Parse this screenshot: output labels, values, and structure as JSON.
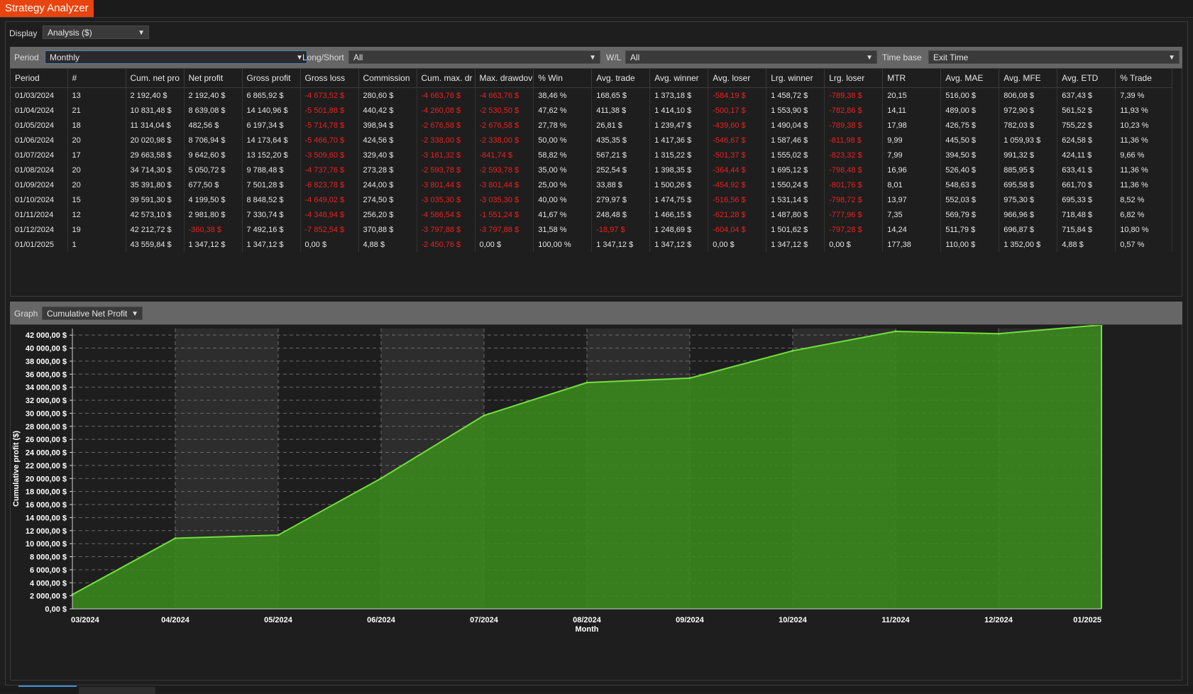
{
  "app": {
    "title": "Strategy Analyzer"
  },
  "display": {
    "label": "Display",
    "value": "Analysis ($)"
  },
  "filters": [
    {
      "label": "Period",
      "value": "Monthly"
    },
    {
      "label": "Long/Short",
      "value": "All"
    },
    {
      "label": "W/L",
      "value": "All"
    },
    {
      "label": "Time base",
      "value": "Exit Time"
    }
  ],
  "colors": {
    "accent": "#e8440f",
    "negative": "#ee2020",
    "area_fill": "#3a8a1e",
    "line": "#72e03a",
    "band": "#2d2d2d"
  },
  "table": {
    "columns": [
      "Period",
      "#",
      "Cum. net pro",
      "Net profit",
      "Gross profit",
      "Gross loss",
      "Commission",
      "Cum. max. dr",
      "Max. drawdov",
      "% Win",
      "Avg. trade",
      "Avg. winner",
      "Avg. loser",
      "Lrg. winner",
      "Lrg. loser",
      "MTR",
      "Avg. MAE",
      "Avg. MFE",
      "Avg. ETD",
      "% Trade"
    ],
    "rows": [
      [
        "01/03/2024",
        "13",
        "2 192,40 $",
        "2 192,40 $",
        "6 865,92 $",
        "-4 673,52 $",
        "280,60 $",
        "-4 663,76 $",
        "-4 663,76 $",
        "38,46 %",
        "168,65 $",
        "1 373,18 $",
        "-584,19 $",
        "1 458,72 $",
        "-789,38 $",
        "20,15",
        "516,00 $",
        "806,08 $",
        "637,43 $",
        "7,39 %"
      ],
      [
        "01/04/2024",
        "21",
        "10 831,48 $",
        "8 639,08 $",
        "14 140,96 $",
        "-5 501,88 $",
        "440,42 $",
        "-4 260,08 $",
        "-2 530,50 $",
        "47,62 %",
        "411,38 $",
        "1 414,10 $",
        "-500,17 $",
        "1 553,90 $",
        "-782,86 $",
        "14,11",
        "489,00 $",
        "972,90 $",
        "561,52 $",
        "11,93 %"
      ],
      [
        "01/05/2024",
        "18",
        "11 314,04 $",
        "482,56 $",
        "6 197,34 $",
        "-5 714,78 $",
        "398,94 $",
        "-2 676,58 $",
        "-2 676,58 $",
        "27,78 %",
        "26,81 $",
        "1 239,47 $",
        "-439,60 $",
        "1 490,04 $",
        "-789,38 $",
        "17,98",
        "426,75 $",
        "782,03 $",
        "755,22 $",
        "10,23 %"
      ],
      [
        "01/06/2024",
        "20",
        "20 020,98 $",
        "8 706,94 $",
        "14 173,64 $",
        "-5 466,70 $",
        "424,56 $",
        "-2 338,00 $",
        "-2 338,00 $",
        "50,00 %",
        "435,35 $",
        "1 417,36 $",
        "-546,67 $",
        "1 587,46 $",
        "-811,98 $",
        "9,99",
        "445,50 $",
        "1 059,93 $",
        "624,58 $",
        "11,36 %"
      ],
      [
        "01/07/2024",
        "17",
        "29 663,58 $",
        "9 642,60 $",
        "13 152,20 $",
        "-3 509,60 $",
        "329,40 $",
        "-3 161,32 $",
        "-841,74 $",
        "58,82 %",
        "567,21 $",
        "1 315,22 $",
        "-501,37 $",
        "1 555,02 $",
        "-823,32 $",
        "7,99",
        "394,50 $",
        "991,32 $",
        "424,11 $",
        "9,66 %"
      ],
      [
        "01/08/2024",
        "20",
        "34 714,30 $",
        "5 050,72 $",
        "9 788,48 $",
        "-4 737,76 $",
        "273,28 $",
        "-2 593,78 $",
        "-2 593,78 $",
        "35,00 %",
        "252,54 $",
        "1 398,35 $",
        "-364,44 $",
        "1 695,12 $",
        "-798,48 $",
        "16,96",
        "526,40 $",
        "885,95 $",
        "633,41 $",
        "11,36 %"
      ],
      [
        "01/09/2024",
        "20",
        "35 391,80 $",
        "677,50 $",
        "7 501,28 $",
        "-6 823,78 $",
        "244,00 $",
        "-3 801,44 $",
        "-3 801,44 $",
        "25,00 %",
        "33,88 $",
        "1 500,26 $",
        "-454,92 $",
        "1 550,24 $",
        "-801,76 $",
        "8,01",
        "548,63 $",
        "695,58 $",
        "661,70 $",
        "11,36 %"
      ],
      [
        "01/10/2024",
        "15",
        "39 591,30 $",
        "4 199,50 $",
        "8 848,52 $",
        "-4 649,02 $",
        "274,50 $",
        "-3 035,30 $",
        "-3 035,30 $",
        "40,00 %",
        "279,97 $",
        "1 474,75 $",
        "-516,56 $",
        "1 531,14 $",
        "-798,72 $",
        "13,97",
        "552,03 $",
        "975,30 $",
        "695,33 $",
        "8,52 %"
      ],
      [
        "01/11/2024",
        "12",
        "42 573,10 $",
        "2 981,80 $",
        "7 330,74 $",
        "-4 348,94 $",
        "256,20 $",
        "-4 586,54 $",
        "-1 551,24 $",
        "41,67 %",
        "248,48 $",
        "1 466,15 $",
        "-621,28 $",
        "1 487,80 $",
        "-777,96 $",
        "7,35",
        "569,79 $",
        "966,96 $",
        "718,48 $",
        "6,82 %"
      ],
      [
        "01/12/2024",
        "19",
        "42 212,72 $",
        "-360,38 $",
        "7 492,16 $",
        "-7 852,54 $",
        "370,88 $",
        "-3 797,88 $",
        "-3 797,88 $",
        "31,58 %",
        "-18,97 $",
        "1 248,69 $",
        "-604,04 $",
        "1 501,62 $",
        "-797,28 $",
        "14,24",
        "511,79 $",
        "696,87 $",
        "715,84 $",
        "10,80 %"
      ],
      [
        "01/01/2025",
        "1",
        "43 559,84 $",
        "1 347,12 $",
        "1 347,12 $",
        "0,00 $",
        "4,88 $",
        "-2 450,76 $",
        "0,00 $",
        "100,00 %",
        "1 347,12 $",
        "1 347,12 $",
        "0,00 $",
        "1 347,12 $",
        "0,00 $",
        "177,38",
        "110,00 $",
        "1 352,00 $",
        "4,88 $",
        "0,57 %"
      ]
    ]
  },
  "graph": {
    "label": "Graph",
    "value": "Cumulative Net Profit"
  },
  "chart_data": {
    "type": "area",
    "x": [
      "03/2024",
      "04/2024",
      "05/2024",
      "06/2024",
      "07/2024",
      "08/2024",
      "09/2024",
      "10/2024",
      "11/2024",
      "12/2024",
      "01/2025"
    ],
    "series": [
      {
        "values": [
          2192.4,
          10831.48,
          11314.04,
          20020.98,
          29663.58,
          34714.3,
          35391.8,
          39591.3,
          42573.1,
          42212.72,
          43559.84
        ]
      }
    ],
    "xlabel": "Month",
    "ylabel": "Cumulative profit ($)",
    "ylim": [
      0,
      43000
    ],
    "yticks": [
      "0,00 $",
      "2 000,00 $",
      "4 000,00 $",
      "6 000,00 $",
      "8 000,00 $",
      "10 000,00 $",
      "12 000,00 $",
      "14 000,00 $",
      "16 000,00 $",
      "18 000,00 $",
      "20 000,00 $",
      "22 000,00 $",
      "24 000,00 $",
      "26 000,00 $",
      "28 000,00 $",
      "30 000,00 $",
      "32 000,00 $",
      "34 000,00 $",
      "36 000,00 $",
      "38 000,00 $",
      "40 000,00 $",
      "42 000,00 $"
    ],
    "grid": true
  }
}
